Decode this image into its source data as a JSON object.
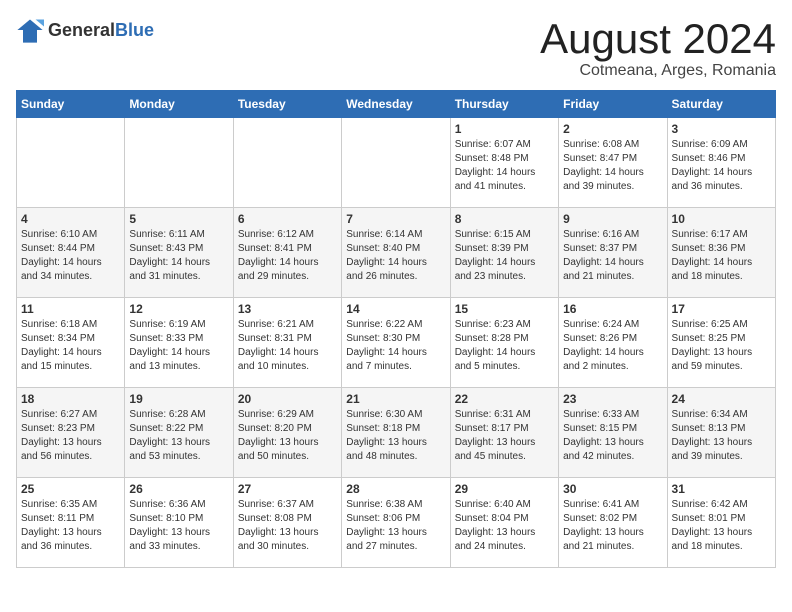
{
  "logo": {
    "general": "General",
    "blue": "Blue"
  },
  "title": "August 2024",
  "subtitle": "Cotmeana, Arges, Romania",
  "days_of_week": [
    "Sunday",
    "Monday",
    "Tuesday",
    "Wednesday",
    "Thursday",
    "Friday",
    "Saturday"
  ],
  "weeks": [
    [
      {
        "day": "",
        "info": ""
      },
      {
        "day": "",
        "info": ""
      },
      {
        "day": "",
        "info": ""
      },
      {
        "day": "",
        "info": ""
      },
      {
        "day": "1",
        "info": "Sunrise: 6:07 AM\nSunset: 8:48 PM\nDaylight: 14 hours\nand 41 minutes."
      },
      {
        "day": "2",
        "info": "Sunrise: 6:08 AM\nSunset: 8:47 PM\nDaylight: 14 hours\nand 39 minutes."
      },
      {
        "day": "3",
        "info": "Sunrise: 6:09 AM\nSunset: 8:46 PM\nDaylight: 14 hours\nand 36 minutes."
      }
    ],
    [
      {
        "day": "4",
        "info": "Sunrise: 6:10 AM\nSunset: 8:44 PM\nDaylight: 14 hours\nand 34 minutes."
      },
      {
        "day": "5",
        "info": "Sunrise: 6:11 AM\nSunset: 8:43 PM\nDaylight: 14 hours\nand 31 minutes."
      },
      {
        "day": "6",
        "info": "Sunrise: 6:12 AM\nSunset: 8:41 PM\nDaylight: 14 hours\nand 29 minutes."
      },
      {
        "day": "7",
        "info": "Sunrise: 6:14 AM\nSunset: 8:40 PM\nDaylight: 14 hours\nand 26 minutes."
      },
      {
        "day": "8",
        "info": "Sunrise: 6:15 AM\nSunset: 8:39 PM\nDaylight: 14 hours\nand 23 minutes."
      },
      {
        "day": "9",
        "info": "Sunrise: 6:16 AM\nSunset: 8:37 PM\nDaylight: 14 hours\nand 21 minutes."
      },
      {
        "day": "10",
        "info": "Sunrise: 6:17 AM\nSunset: 8:36 PM\nDaylight: 14 hours\nand 18 minutes."
      }
    ],
    [
      {
        "day": "11",
        "info": "Sunrise: 6:18 AM\nSunset: 8:34 PM\nDaylight: 14 hours\nand 15 minutes."
      },
      {
        "day": "12",
        "info": "Sunrise: 6:19 AM\nSunset: 8:33 PM\nDaylight: 14 hours\nand 13 minutes."
      },
      {
        "day": "13",
        "info": "Sunrise: 6:21 AM\nSunset: 8:31 PM\nDaylight: 14 hours\nand 10 minutes."
      },
      {
        "day": "14",
        "info": "Sunrise: 6:22 AM\nSunset: 8:30 PM\nDaylight: 14 hours\nand 7 minutes."
      },
      {
        "day": "15",
        "info": "Sunrise: 6:23 AM\nSunset: 8:28 PM\nDaylight: 14 hours\nand 5 minutes."
      },
      {
        "day": "16",
        "info": "Sunrise: 6:24 AM\nSunset: 8:26 PM\nDaylight: 14 hours\nand 2 minutes."
      },
      {
        "day": "17",
        "info": "Sunrise: 6:25 AM\nSunset: 8:25 PM\nDaylight: 13 hours\nand 59 minutes."
      }
    ],
    [
      {
        "day": "18",
        "info": "Sunrise: 6:27 AM\nSunset: 8:23 PM\nDaylight: 13 hours\nand 56 minutes."
      },
      {
        "day": "19",
        "info": "Sunrise: 6:28 AM\nSunset: 8:22 PM\nDaylight: 13 hours\nand 53 minutes."
      },
      {
        "day": "20",
        "info": "Sunrise: 6:29 AM\nSunset: 8:20 PM\nDaylight: 13 hours\nand 50 minutes."
      },
      {
        "day": "21",
        "info": "Sunrise: 6:30 AM\nSunset: 8:18 PM\nDaylight: 13 hours\nand 48 minutes."
      },
      {
        "day": "22",
        "info": "Sunrise: 6:31 AM\nSunset: 8:17 PM\nDaylight: 13 hours\nand 45 minutes."
      },
      {
        "day": "23",
        "info": "Sunrise: 6:33 AM\nSunset: 8:15 PM\nDaylight: 13 hours\nand 42 minutes."
      },
      {
        "day": "24",
        "info": "Sunrise: 6:34 AM\nSunset: 8:13 PM\nDaylight: 13 hours\nand 39 minutes."
      }
    ],
    [
      {
        "day": "25",
        "info": "Sunrise: 6:35 AM\nSunset: 8:11 PM\nDaylight: 13 hours\nand 36 minutes."
      },
      {
        "day": "26",
        "info": "Sunrise: 6:36 AM\nSunset: 8:10 PM\nDaylight: 13 hours\nand 33 minutes."
      },
      {
        "day": "27",
        "info": "Sunrise: 6:37 AM\nSunset: 8:08 PM\nDaylight: 13 hours\nand 30 minutes."
      },
      {
        "day": "28",
        "info": "Sunrise: 6:38 AM\nSunset: 8:06 PM\nDaylight: 13 hours\nand 27 minutes."
      },
      {
        "day": "29",
        "info": "Sunrise: 6:40 AM\nSunset: 8:04 PM\nDaylight: 13 hours\nand 24 minutes."
      },
      {
        "day": "30",
        "info": "Sunrise: 6:41 AM\nSunset: 8:02 PM\nDaylight: 13 hours\nand 21 minutes."
      },
      {
        "day": "31",
        "info": "Sunrise: 6:42 AM\nSunset: 8:01 PM\nDaylight: 13 hours\nand 18 minutes."
      }
    ]
  ]
}
